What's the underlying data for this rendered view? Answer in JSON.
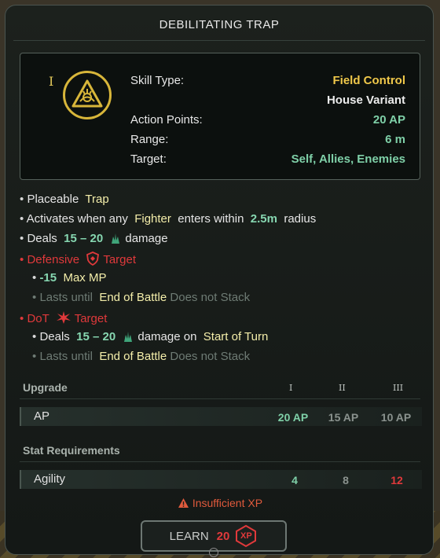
{
  "title": "DEBILITATING TRAP",
  "skill": {
    "tier": "I",
    "skill_type_label": "Skill Type:",
    "skill_type_value": "Field Control",
    "variant": "House Variant",
    "ap_label": "Action Points:",
    "ap_value": "20 AP",
    "range_label": "Range:",
    "range_value": "6 m",
    "target_label": "Target:",
    "target_value": "Self, Allies, Enemies"
  },
  "effects": {
    "l1_pre": "Placeable",
    "l1_hl": "Trap",
    "l2_pre": "Activates when any",
    "l2_hl": "Fighter",
    "l2_mid": "enters within",
    "l2_num": "2.5m",
    "l2_post": "radius",
    "l3_pre": "Deals",
    "l3_num": "15 – 20",
    "l3_post": "damage",
    "l4_a": "Defensive",
    "l4_b": "Target",
    "l5_num": "-15",
    "l5_post": "Max MP",
    "l6_pre": "Lasts until",
    "l6_hl": "End of Battle",
    "l6_post": "Does not Stack",
    "l7_a": "DoT",
    "l7_b": "Target",
    "l8_pre": "Deals",
    "l8_num": "15 – 20",
    "l8_mid": "damage on",
    "l8_hl": "Start of Turn",
    "l9_pre": "Lasts until",
    "l9_hl": "End of Battle",
    "l9_post": "Does not Stack"
  },
  "upgrade": {
    "title": "Upgrade",
    "tiers": [
      "I",
      "II",
      "III"
    ],
    "row_label": "AP",
    "values": [
      "20 AP",
      "15 AP",
      "10 AP"
    ]
  },
  "requirements": {
    "title": "Stat Requirements",
    "row_label": "Agility",
    "values": [
      "4",
      "8",
      "12"
    ]
  },
  "warning": "Insufficient XP",
  "learn": {
    "label": "LEARN",
    "cost": "20",
    "currency": "XP"
  },
  "colors": {
    "accent_gold": "#f0c84a",
    "accent_green": "#7fd0a8",
    "alert_red": "#e0393b"
  }
}
